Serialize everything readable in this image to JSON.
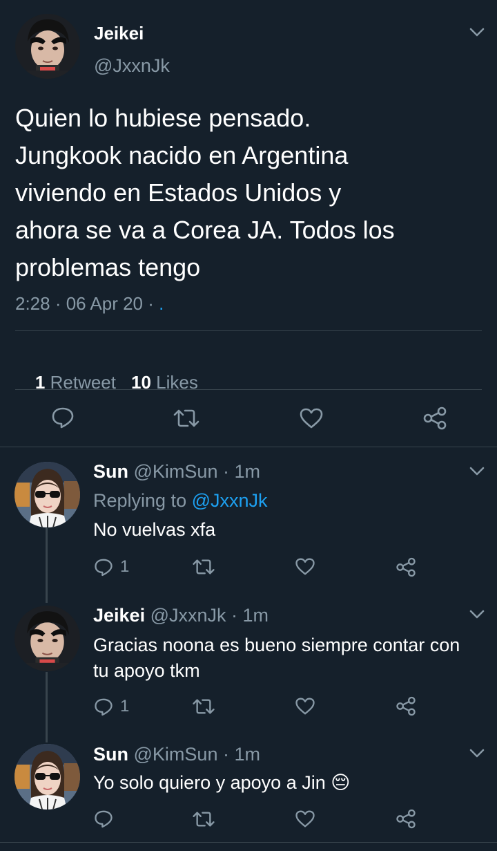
{
  "main_tweet": {
    "name": "Jeikei",
    "handle": "@JxxnJk",
    "lines": [
      "Quien lo hubiese pensado.",
      "Jungkook nacido en Argentina",
      "viviendo en Estados Unidos y",
      "ahora se va a Corea JA. Todos los",
      "problemas tengo"
    ],
    "time": "2:28 · 06 Apr 20 · ",
    "source": ".",
    "retweets_count": "1",
    "retweets_label": "Retweet",
    "likes_count": "10",
    "likes_label": "Likes"
  },
  "replies": [
    {
      "name": "Sun",
      "handle": "@KimSun",
      "time": " · 1m",
      "replying_label": "Replying to ",
      "replying_handle": "@JxxnJk",
      "text_lines": [
        "No vuelvas xfa"
      ],
      "reply_count": "1"
    },
    {
      "name": "Jeikei",
      "handle": "@JxxnJk",
      "time": " · 1m",
      "text_lines": [
        "Gracias noona es bueno siempre contar con",
        "tu apoyo tkm"
      ],
      "reply_count": "1"
    },
    {
      "name": "Sun",
      "handle": "@KimSun",
      "time": " · 1m",
      "text_lines": [
        "Yo solo quiero y apoyo a Jin"
      ],
      "emoji": "😔",
      "reply_count": ""
    }
  ],
  "colors": {
    "background": "#15202b",
    "secondary_text": "#8899a6",
    "link": "#1da1f2",
    "divider": "#38444d"
  },
  "icons": [
    "chevron-down-icon",
    "reply-icon",
    "retweet-icon",
    "like-icon",
    "share-icon"
  ]
}
